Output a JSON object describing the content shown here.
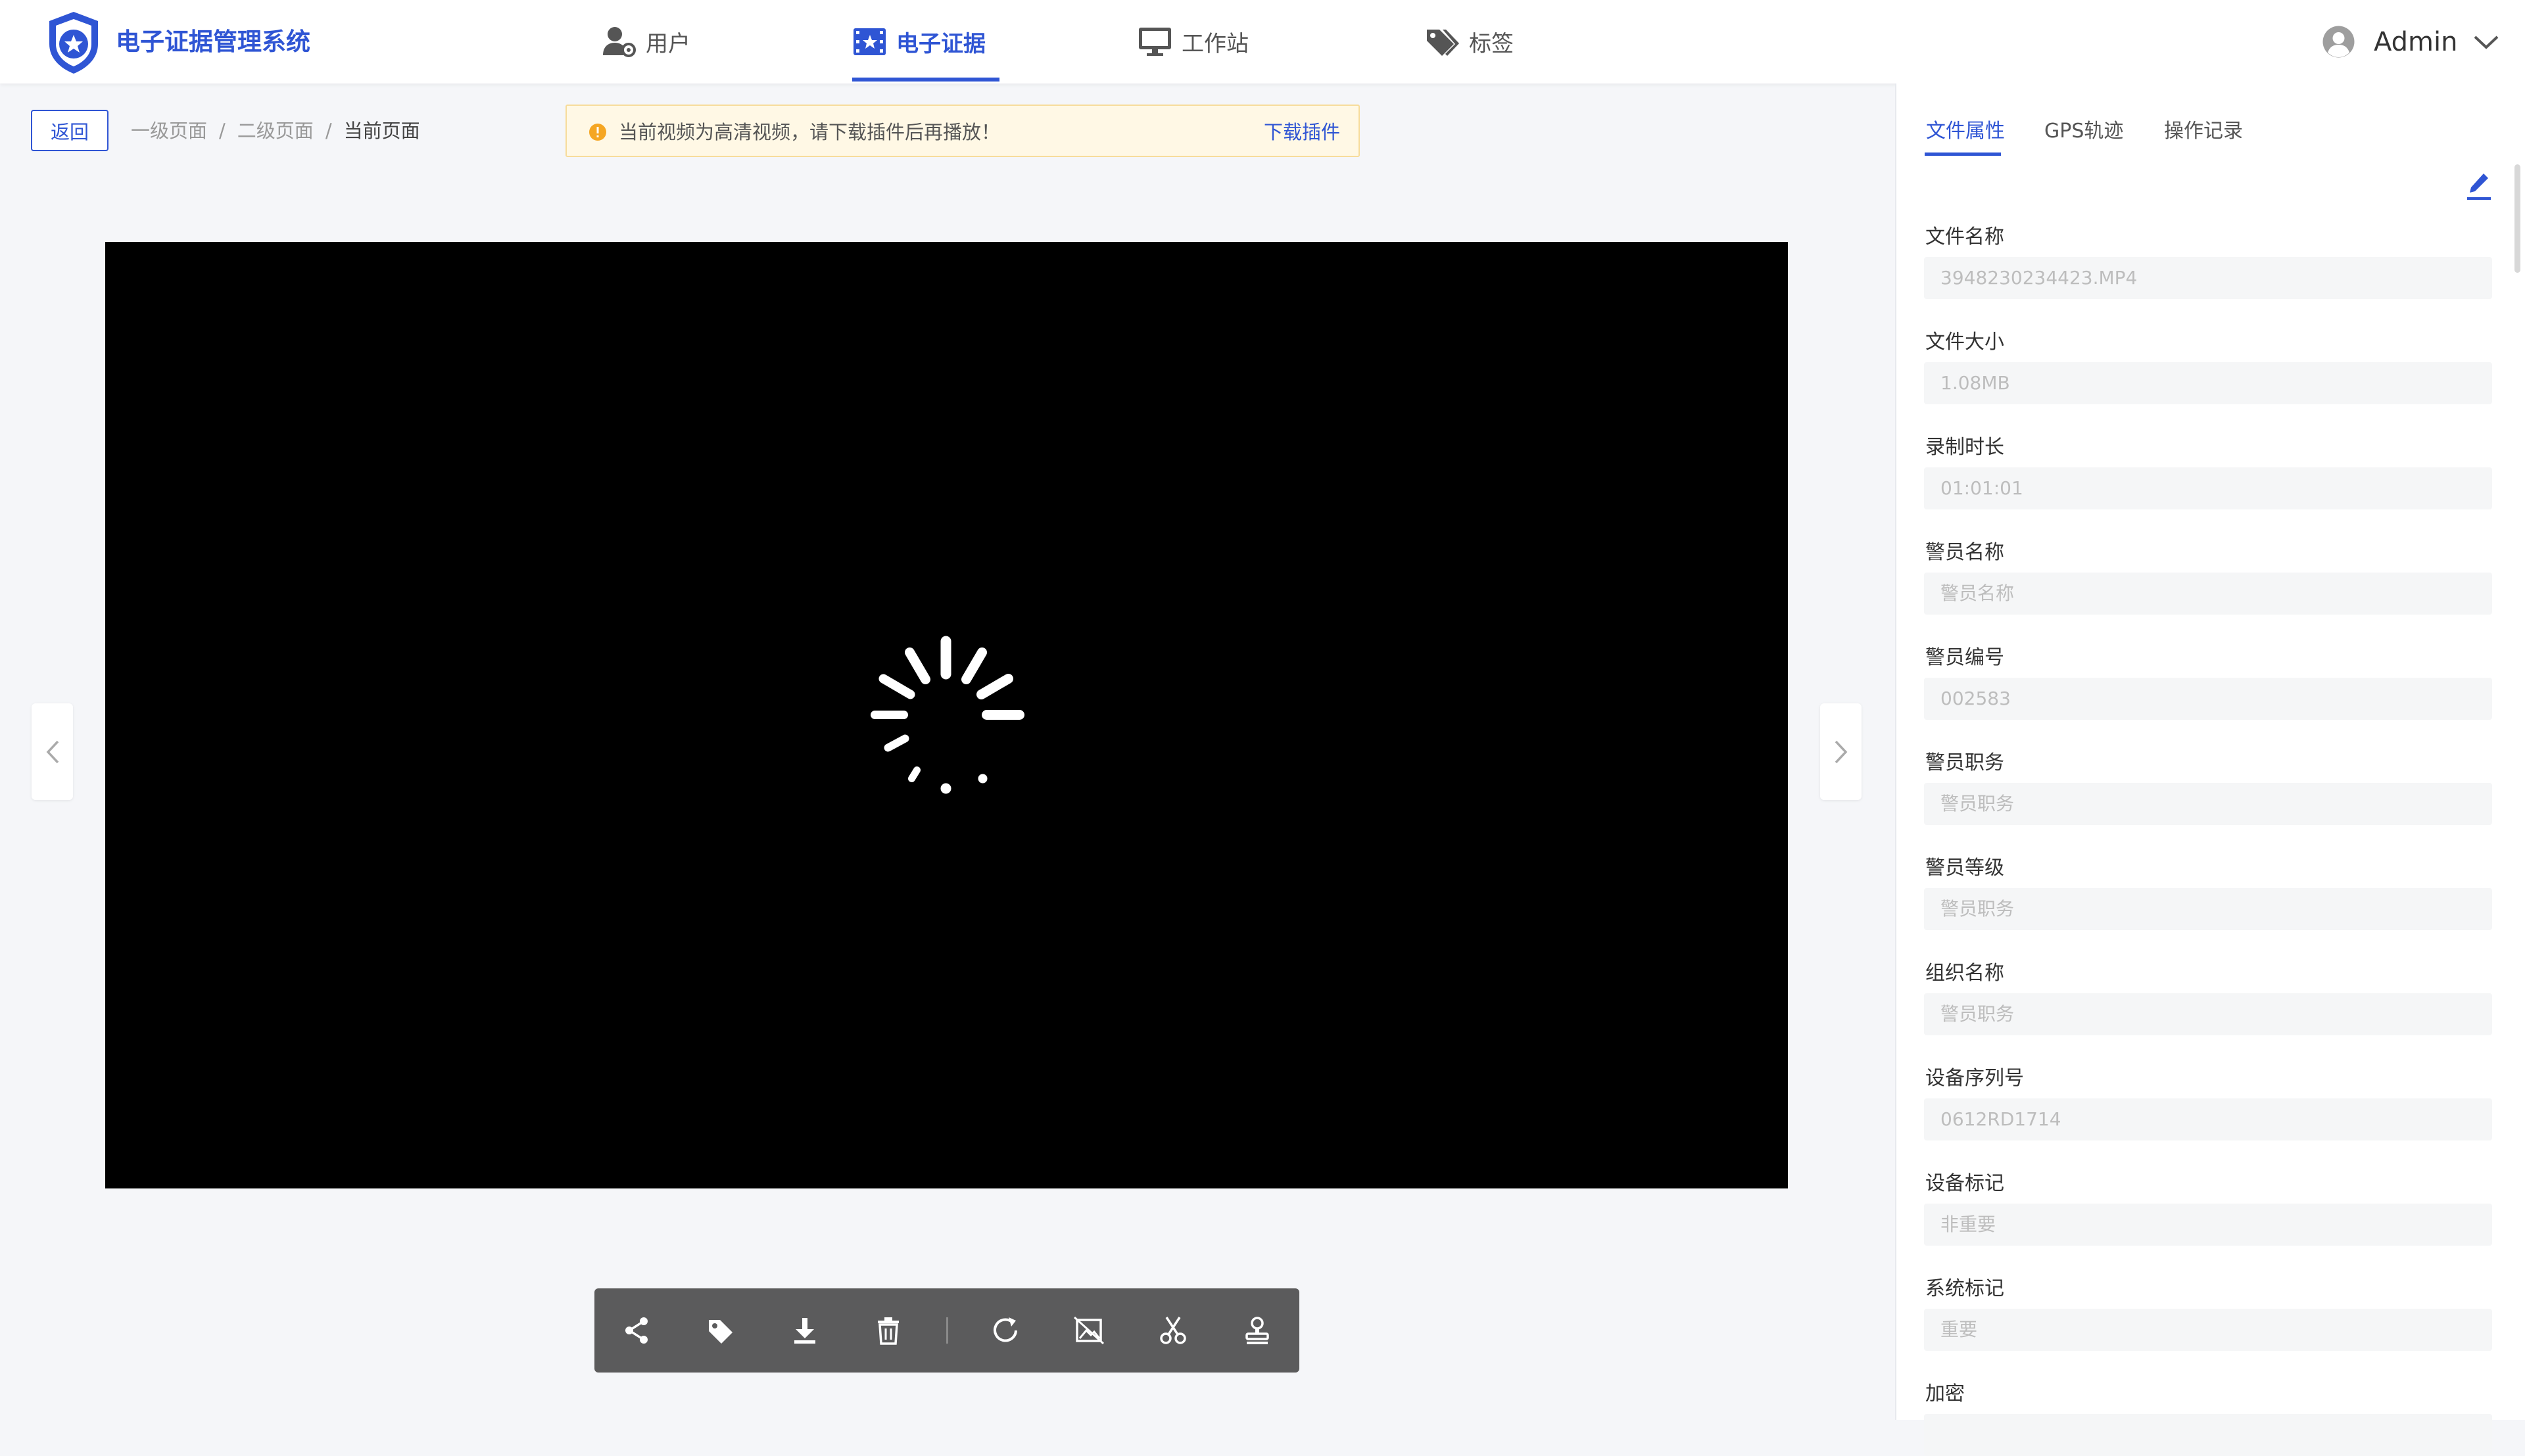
{
  "app": {
    "title": "电子证据管理系统"
  },
  "nav": [
    {
      "label": "用户",
      "icon": "user-gear-icon"
    },
    {
      "label": "电子证据",
      "icon": "film-badge-icon"
    },
    {
      "label": "工作站",
      "icon": "monitor-icon"
    },
    {
      "label": "标签",
      "icon": "tags-icon"
    }
  ],
  "user": {
    "name": "Admin"
  },
  "actions": {
    "back": "返回"
  },
  "breadcrumb": [
    "一级页面",
    "二级页面",
    "当前页面"
  ],
  "alert": {
    "message": "当前视频为高清视频，请下载插件后再播放！",
    "action": "下载插件"
  },
  "toolbar": [
    "share-icon",
    "tag-icon",
    "download-icon",
    "delete-icon",
    "rotate-icon",
    "crop-icon",
    "cut-icon",
    "stamp-icon"
  ],
  "panel": {
    "tabs": [
      "文件属性",
      "GPS轨迹",
      "操作记录"
    ],
    "fields": [
      {
        "label": "文件名称",
        "value": "3948230234423.MP4"
      },
      {
        "label": "文件大小",
        "value": "1.08MB"
      },
      {
        "label": "录制时长",
        "value": "01:01:01"
      },
      {
        "label": "警员名称",
        "value": "警员名称"
      },
      {
        "label": "警员编号",
        "value": "002583"
      },
      {
        "label": "警员职务",
        "value": "警员职务"
      },
      {
        "label": "警员等级",
        "value": "警员职务"
      },
      {
        "label": "组织名称",
        "value": "警员职务"
      },
      {
        "label": "设备序列号",
        "value": "0612RD1714"
      },
      {
        "label": "设备标记",
        "value": "非重要"
      },
      {
        "label": "系统标记",
        "value": "重要"
      },
      {
        "label": "加密",
        "value": ""
      }
    ]
  },
  "colors": {
    "primary": "#2f55d4",
    "alert_bg": "#fff8e5",
    "warning": "#f5a623",
    "toolbar": "#5b5b5c"
  }
}
